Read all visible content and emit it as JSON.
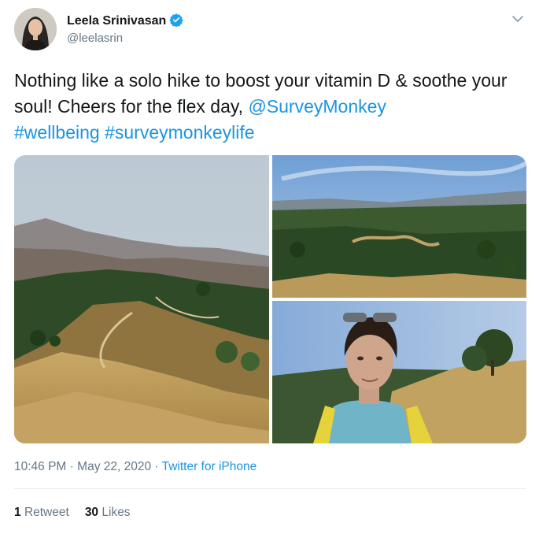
{
  "author": {
    "name": "Leela Srinivasan",
    "handle": "@leelasrin",
    "verified": true
  },
  "tweet": {
    "text_plain": "Nothing like a solo hike to boost your vitamin D & soothe your soul! Cheers for the flex day, ",
    "mention": "@SurveyMonkey",
    "hashtag1": "#wellbeing",
    "hashtag2": "#surveymonkeylife"
  },
  "media": {
    "photos": [
      "golden-hills-photo",
      "valley-view-photo",
      "selfie-photo"
    ]
  },
  "meta": {
    "time": "10:46 PM",
    "separator": "·",
    "date": "May 22, 2020",
    "source": "Twitter for iPhone"
  },
  "stats": {
    "retweets_count": "1",
    "retweets_label": "Retweet",
    "likes_count": "30",
    "likes_label": "Likes"
  },
  "colors": {
    "link": "#1b95e0",
    "text": "#14171a",
    "secondary": "#657786",
    "divider": "#e6ecf0"
  }
}
